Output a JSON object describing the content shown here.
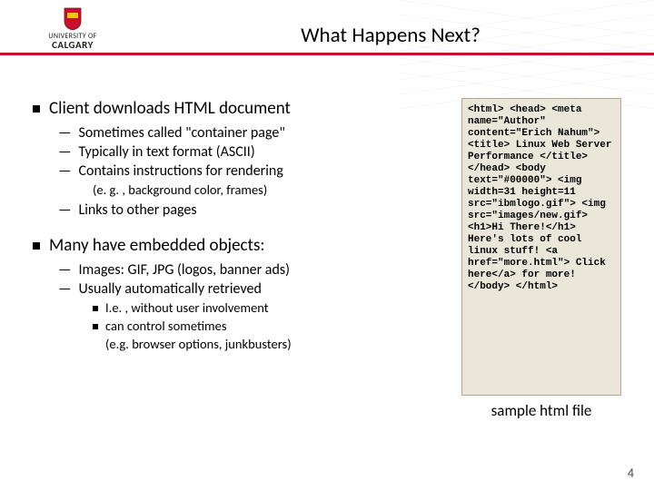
{
  "header": {
    "title": "What Happens Next?",
    "logo_line1": "UNIVERSITY OF",
    "logo_line2": "CALGARY"
  },
  "left": {
    "section1": {
      "heading": "Client downloads HTML document",
      "sub1": "Sometimes called \"container page\"",
      "sub2": "Typically in text format (ASCII)",
      "sub3": "Contains instructions for rendering",
      "sub3_note": "(e. g. , background color, frames)",
      "sub4": "Links to other pages"
    },
    "section2": {
      "heading": "Many have embedded objects:",
      "sub1": "Images: GIF, JPG (logos, banner ads)",
      "sub2": "Usually automatically retrieved",
      "sub2_a": "I.e. , without user involvement",
      "sub2_b": "can control sometimes",
      "sub2_b_note": "(e.g. browser options, junkbusters)"
    }
  },
  "code": "<html>\n<head>\n<meta name=\"Author\" content=\"Erich Nahum\">\n<title> Linux Web Server Performance </title>\n</head>\n<body text=\"#00000\">\n<img width=31 height=11 src=\"ibmlogo.gif\">\n<img src=\"images/new.gif>\n<h1>Hi There!</h1>\nHere's lots of cool linux stuff!\n<a href=\"more.html\"> Click here</a>\nfor more!\n</body>\n</html>",
  "caption": "sample html file",
  "page_number": "4"
}
